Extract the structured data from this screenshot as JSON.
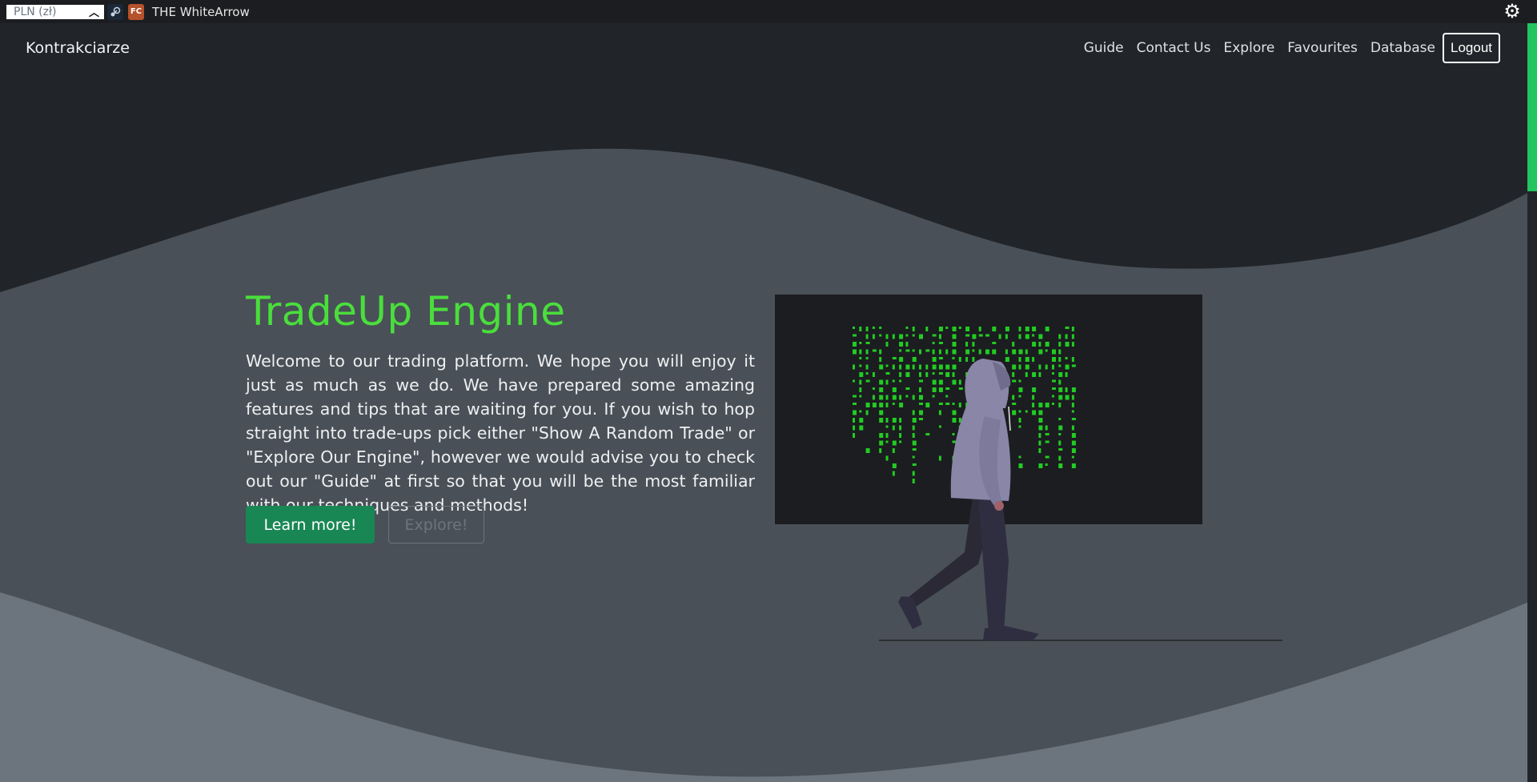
{
  "extension_bar": {
    "currency_value": "PLN (zł)",
    "username": "THE WhiteArrow",
    "icons": [
      "chevron-up-icon",
      "steam-icon",
      "fc-extension-icon",
      "gear-icon"
    ]
  },
  "navbar": {
    "brand": "Kontrakciarze",
    "links": [
      "Guide",
      "Contact Us",
      "Explore",
      "Favourites",
      "Database"
    ],
    "logout_label": "Logout"
  },
  "hero": {
    "title": "TradeUp Engine",
    "description": "Welcome to our trading platform. We hope you will enjoy it just as much as we do. We have prepared some amazing features and tips that are waiting for you. If you wish to hop straight into trade-ups pick either \"Show A Random Trade\" or \"Explore Our Engine\", however we would advise you to check out our \"Guide\" at first so that you will be the most familiar with our techniques and methods!",
    "primary_button": "Learn more!",
    "secondary_button": "Explore!"
  },
  "colors": {
    "background": "#212529",
    "wave_mid": "#495057",
    "wave_light": "#6c757d",
    "accent_green": "#4ade3c",
    "button_green": "#198754",
    "matrix_green": "#22cc22"
  }
}
